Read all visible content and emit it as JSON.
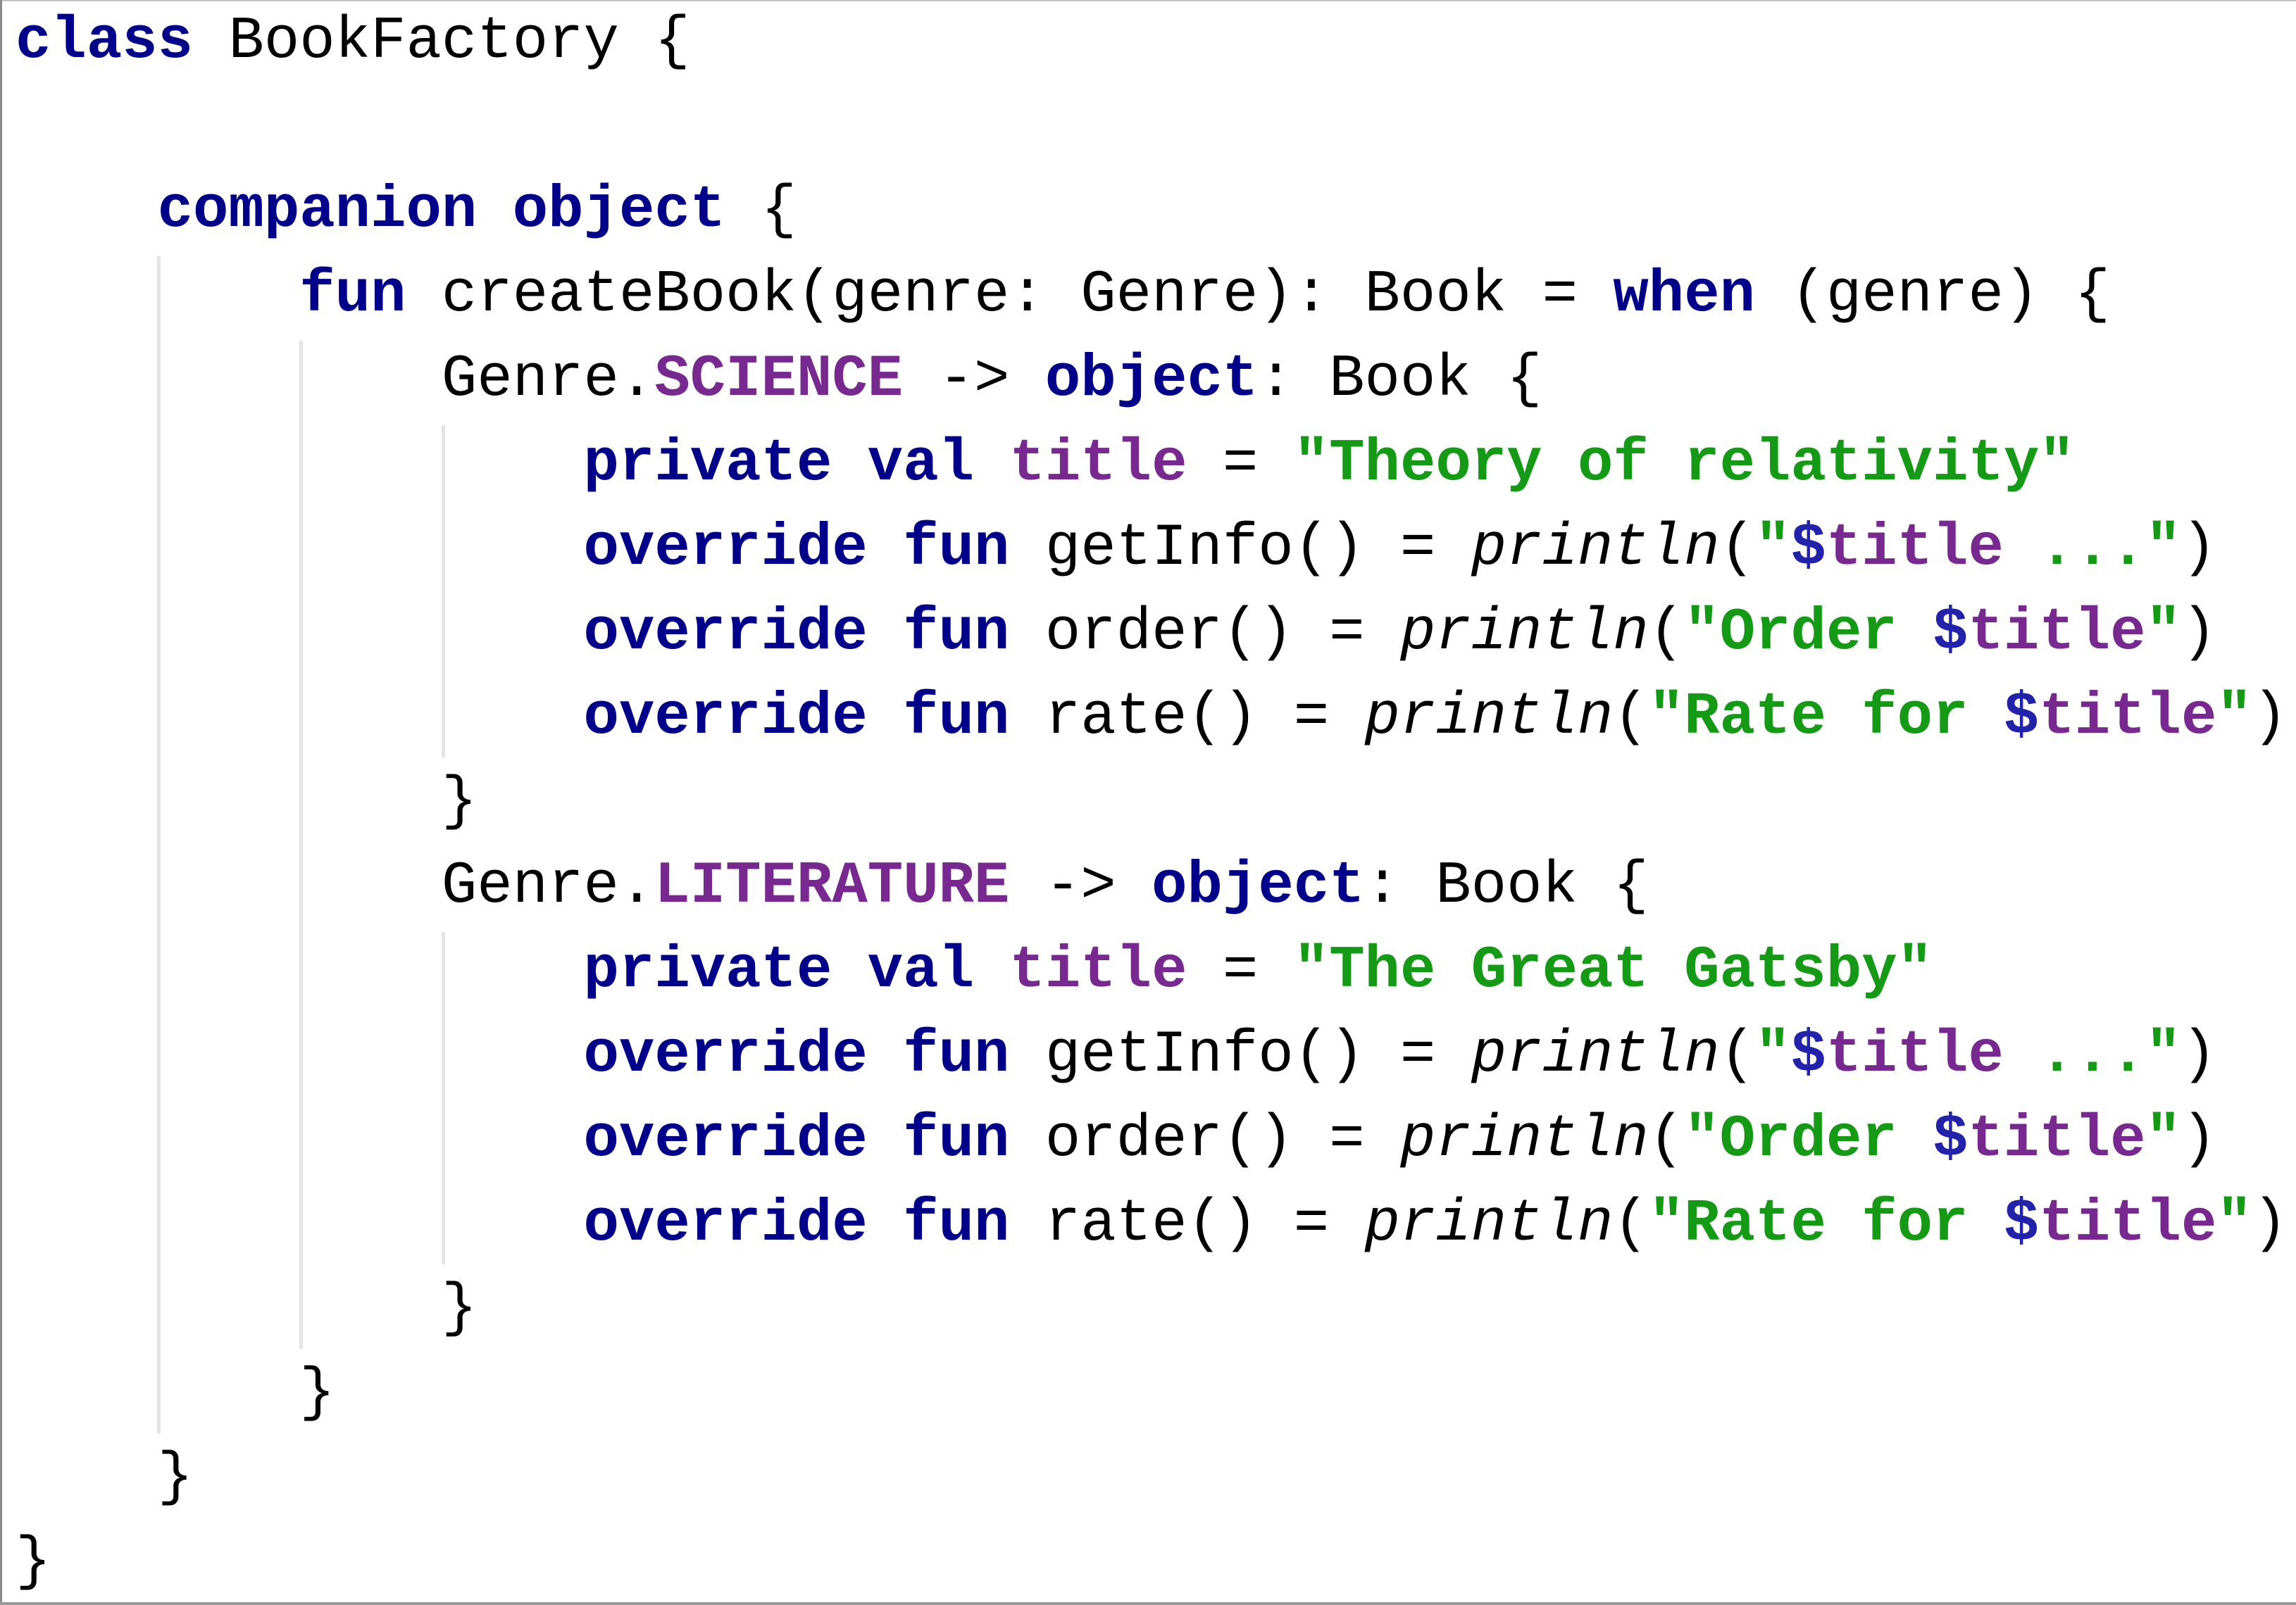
{
  "editor": {
    "language": "kotlin",
    "colors": {
      "keyword": "#00008b",
      "constant": "#772990",
      "property": "#772990",
      "string": "#149a14",
      "template_dollar": "#2222aa",
      "plain": "#000000",
      "indent_guide": "#e4e4e4",
      "background": "#ffffff"
    },
    "lines": [
      {
        "tokens": [
          {
            "t": "class",
            "c": "kw"
          },
          {
            "t": " BookFactory {",
            "c": "plain"
          }
        ]
      },
      {
        "tokens": []
      },
      {
        "tokens": [
          {
            "t": "    ",
            "c": "plain"
          },
          {
            "t": "companion object",
            "c": "kw"
          },
          {
            "t": " {",
            "c": "plain"
          }
        ]
      },
      {
        "tokens": [
          {
            "t": "        ",
            "c": "plain"
          },
          {
            "t": "fun",
            "c": "kw"
          },
          {
            "t": " createBook(genre: Genre): Book = ",
            "c": "plain"
          },
          {
            "t": "when",
            "c": "kw"
          },
          {
            "t": " (genre) {",
            "c": "plain"
          }
        ]
      },
      {
        "tokens": [
          {
            "t": "            Genre.",
            "c": "plain"
          },
          {
            "t": "SCIENCE",
            "c": "const"
          },
          {
            "t": " -> ",
            "c": "plain"
          },
          {
            "t": "object",
            "c": "kw"
          },
          {
            "t": ": Book {",
            "c": "plain"
          }
        ]
      },
      {
        "tokens": [
          {
            "t": "                ",
            "c": "plain"
          },
          {
            "t": "private val",
            "c": "kw"
          },
          {
            "t": " ",
            "c": "plain"
          },
          {
            "t": "title",
            "c": "prop"
          },
          {
            "t": " = ",
            "c": "plain"
          },
          {
            "t": "\"Theory of relativity\"",
            "c": "str"
          }
        ]
      },
      {
        "tokens": [
          {
            "t": "                ",
            "c": "plain"
          },
          {
            "t": "override fun",
            "c": "kw"
          },
          {
            "t": " getInfo() = ",
            "c": "plain"
          },
          {
            "t": "println",
            "c": "call"
          },
          {
            "t": "(",
            "c": "plain"
          },
          {
            "t": "\"",
            "c": "str"
          },
          {
            "t": "$",
            "c": "dollar"
          },
          {
            "t": "title",
            "c": "prop"
          },
          {
            "t": " ...\"",
            "c": "str"
          },
          {
            "t": ")",
            "c": "plain"
          }
        ]
      },
      {
        "tokens": [
          {
            "t": "                ",
            "c": "plain"
          },
          {
            "t": "override fun",
            "c": "kw"
          },
          {
            "t": " order() = ",
            "c": "plain"
          },
          {
            "t": "println",
            "c": "call"
          },
          {
            "t": "(",
            "c": "plain"
          },
          {
            "t": "\"Order ",
            "c": "str"
          },
          {
            "t": "$",
            "c": "dollar"
          },
          {
            "t": "title",
            "c": "prop"
          },
          {
            "t": "\"",
            "c": "str"
          },
          {
            "t": ")",
            "c": "plain"
          }
        ]
      },
      {
        "tokens": [
          {
            "t": "                ",
            "c": "plain"
          },
          {
            "t": "override fun",
            "c": "kw"
          },
          {
            "t": " rate() = ",
            "c": "plain"
          },
          {
            "t": "println",
            "c": "call"
          },
          {
            "t": "(",
            "c": "plain"
          },
          {
            "t": "\"Rate for ",
            "c": "str"
          },
          {
            "t": "$",
            "c": "dollar"
          },
          {
            "t": "title",
            "c": "prop"
          },
          {
            "t": "\"",
            "c": "str"
          },
          {
            "t": ")",
            "c": "plain"
          }
        ]
      },
      {
        "tokens": [
          {
            "t": "            }",
            "c": "plain"
          }
        ]
      },
      {
        "tokens": [
          {
            "t": "            Genre.",
            "c": "plain"
          },
          {
            "t": "LITERATURE",
            "c": "const"
          },
          {
            "t": " -> ",
            "c": "plain"
          },
          {
            "t": "object",
            "c": "kw"
          },
          {
            "t": ": Book {",
            "c": "plain"
          }
        ]
      },
      {
        "tokens": [
          {
            "t": "                ",
            "c": "plain"
          },
          {
            "t": "private val",
            "c": "kw"
          },
          {
            "t": " ",
            "c": "plain"
          },
          {
            "t": "title",
            "c": "prop"
          },
          {
            "t": " = ",
            "c": "plain"
          },
          {
            "t": "\"The Great Gatsby\"",
            "c": "str"
          }
        ]
      },
      {
        "tokens": [
          {
            "t": "                ",
            "c": "plain"
          },
          {
            "t": "override fun",
            "c": "kw"
          },
          {
            "t": " getInfo() = ",
            "c": "plain"
          },
          {
            "t": "println",
            "c": "call"
          },
          {
            "t": "(",
            "c": "plain"
          },
          {
            "t": "\"",
            "c": "str"
          },
          {
            "t": "$",
            "c": "dollar"
          },
          {
            "t": "title",
            "c": "prop"
          },
          {
            "t": " ...\"",
            "c": "str"
          },
          {
            "t": ")",
            "c": "plain"
          }
        ]
      },
      {
        "tokens": [
          {
            "t": "                ",
            "c": "plain"
          },
          {
            "t": "override fun",
            "c": "kw"
          },
          {
            "t": " order() = ",
            "c": "plain"
          },
          {
            "t": "println",
            "c": "call"
          },
          {
            "t": "(",
            "c": "plain"
          },
          {
            "t": "\"Order ",
            "c": "str"
          },
          {
            "t": "$",
            "c": "dollar"
          },
          {
            "t": "title",
            "c": "prop"
          },
          {
            "t": "\"",
            "c": "str"
          },
          {
            "t": ")",
            "c": "plain"
          }
        ]
      },
      {
        "tokens": [
          {
            "t": "                ",
            "c": "plain"
          },
          {
            "t": "override fun",
            "c": "kw"
          },
          {
            "t": " rate() = ",
            "c": "plain"
          },
          {
            "t": "println",
            "c": "call"
          },
          {
            "t": "(",
            "c": "plain"
          },
          {
            "t": "\"Rate for ",
            "c": "str"
          },
          {
            "t": "$",
            "c": "dollar"
          },
          {
            "t": "title",
            "c": "prop"
          },
          {
            "t": "\"",
            "c": "str"
          },
          {
            "t": ")",
            "c": "plain"
          }
        ]
      },
      {
        "tokens": [
          {
            "t": "            }",
            "c": "plain"
          }
        ]
      },
      {
        "tokens": [
          {
            "t": "        }",
            "c": "plain"
          }
        ]
      },
      {
        "tokens": [
          {
            "t": "    }",
            "c": "plain"
          }
        ]
      },
      {
        "tokens": [
          {
            "t": "}",
            "c": "plain"
          }
        ]
      }
    ]
  }
}
